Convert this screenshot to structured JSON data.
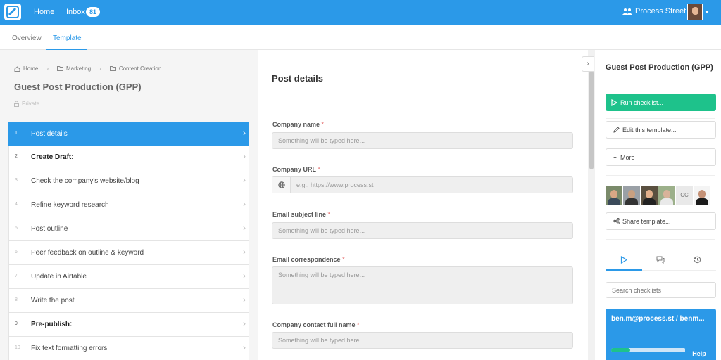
{
  "nav": {
    "home": "Home",
    "inbox": "Inbox",
    "inbox_count": "81",
    "org": "Process Street",
    "brand_color": "#2b99e8"
  },
  "tabs": {
    "overview": "Overview",
    "template": "Template"
  },
  "breadcrumb": {
    "home": "Home",
    "folder1": "Marketing",
    "folder2": "Content Creation"
  },
  "template": {
    "title": "Guest Post Production (GPP)",
    "visibility": "Private"
  },
  "tasks": [
    {
      "num": "1",
      "label": "Post details"
    },
    {
      "num": "2",
      "label": "Create Draft:"
    },
    {
      "num": "3",
      "label": "Check the company's website/blog"
    },
    {
      "num": "4",
      "label": "Refine keyword research"
    },
    {
      "num": "5",
      "label": "Post outline"
    },
    {
      "num": "6",
      "label": "Peer feedback on outline & keyword"
    },
    {
      "num": "7",
      "label": "Update in Airtable"
    },
    {
      "num": "8",
      "label": "Write the post"
    },
    {
      "num": "9",
      "label": "Pre-publish:"
    },
    {
      "num": "10",
      "label": "Fix text formatting errors"
    }
  ],
  "form": {
    "section_title": "Post details",
    "company_name": {
      "label": "Company name",
      "placeholder": "Something will be typed here..."
    },
    "company_url": {
      "label": "Company URL",
      "placeholder": "e.g., https://www.process.st"
    },
    "email_subject": {
      "label": "Email subject line",
      "placeholder": "Something will be typed here..."
    },
    "email_correspondence": {
      "label": "Email correspondence",
      "placeholder": "Something will be typed here..."
    },
    "contact_name": {
      "label": "Company contact full name",
      "placeholder": "Something will be typed here..."
    },
    "required_mark": "*"
  },
  "right": {
    "title": "Guest Post Production (GPP)",
    "run": "Run checklist...",
    "edit": "Edit this template...",
    "more": "More",
    "avatar_initials": "CC",
    "share": "Share template...",
    "search_placeholder": "Search checklists",
    "card_title": "ben.m@process.st / benm...",
    "card_progress": 0.25,
    "help": "Help",
    "run_color": "#1ec28b"
  }
}
